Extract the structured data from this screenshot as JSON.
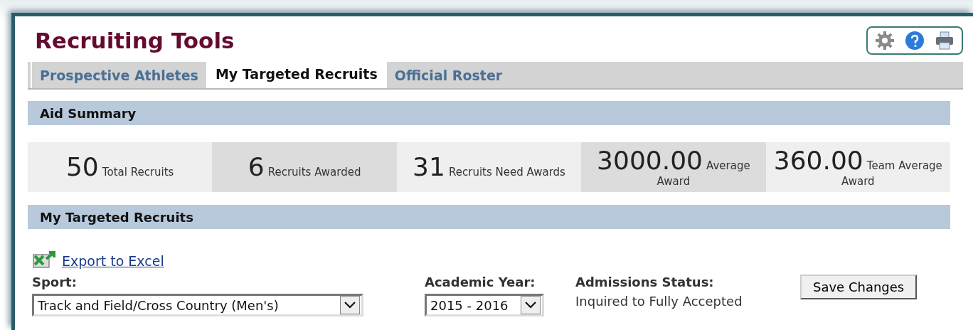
{
  "page": {
    "title": "Recruiting Tools"
  },
  "toolbar": [
    {
      "kind": "settings"
    },
    {
      "kind": "help"
    },
    {
      "kind": "print"
    }
  ],
  "tabs": [
    {
      "label": "Prospective Athletes",
      "selected": false
    },
    {
      "label": "My Targeted Recruits",
      "selected": true
    },
    {
      "label": "Official Roster",
      "selected": false
    }
  ],
  "aid_summary": {
    "heading": "Aid Summary",
    "stats": [
      {
        "value": "50",
        "label": "Total Recruits"
      },
      {
        "value": "6",
        "label": "Recruits Awarded"
      },
      {
        "value": "31",
        "label": "Recruits Need Awards"
      },
      {
        "value": "3000.00",
        "label": "Average Award"
      },
      {
        "value": "360.00",
        "label": "Team Average Award"
      }
    ]
  },
  "recruits": {
    "heading": "My Targeted Recruits",
    "export_link": "Export to Excel",
    "sport": {
      "label": "Sport:",
      "value": "Track and Field/Cross Country (Men's)"
    },
    "academic_year": {
      "label": "Academic Year:",
      "value": "2015 - 2016"
    },
    "admissions_status": {
      "label": "Admissions Status:",
      "value": "Inquired to Fully Accepted"
    },
    "save_button": "Save Changes"
  }
}
